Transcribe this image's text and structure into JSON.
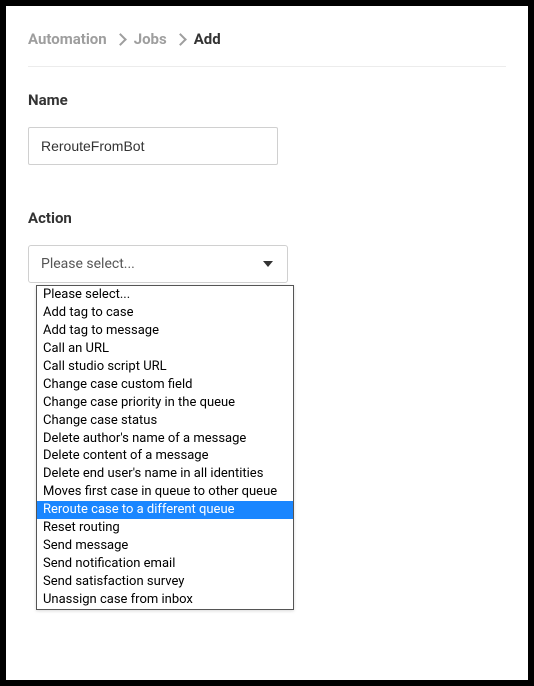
{
  "breadcrumb": {
    "items": [
      "Automation",
      "Jobs"
    ],
    "current": "Add"
  },
  "name_field": {
    "label": "Name",
    "value": "RerouteFromBot"
  },
  "action_field": {
    "label": "Action",
    "placeholder": "Please select...",
    "selected_index": 12,
    "options": [
      "Please select...",
      "Add tag to case",
      "Add tag to message",
      "Call an URL",
      "Call studio script URL",
      "Change case custom field",
      "Change case priority in the queue",
      "Change case status",
      "Delete author's name of a message",
      "Delete content of a message",
      "Delete end user's name in all identities",
      "Moves first case in queue to other queue",
      "Reroute case to a different queue",
      "Reset routing",
      "Send message",
      "Send notification email",
      "Send satisfaction survey",
      "Unassign case from inbox"
    ]
  }
}
